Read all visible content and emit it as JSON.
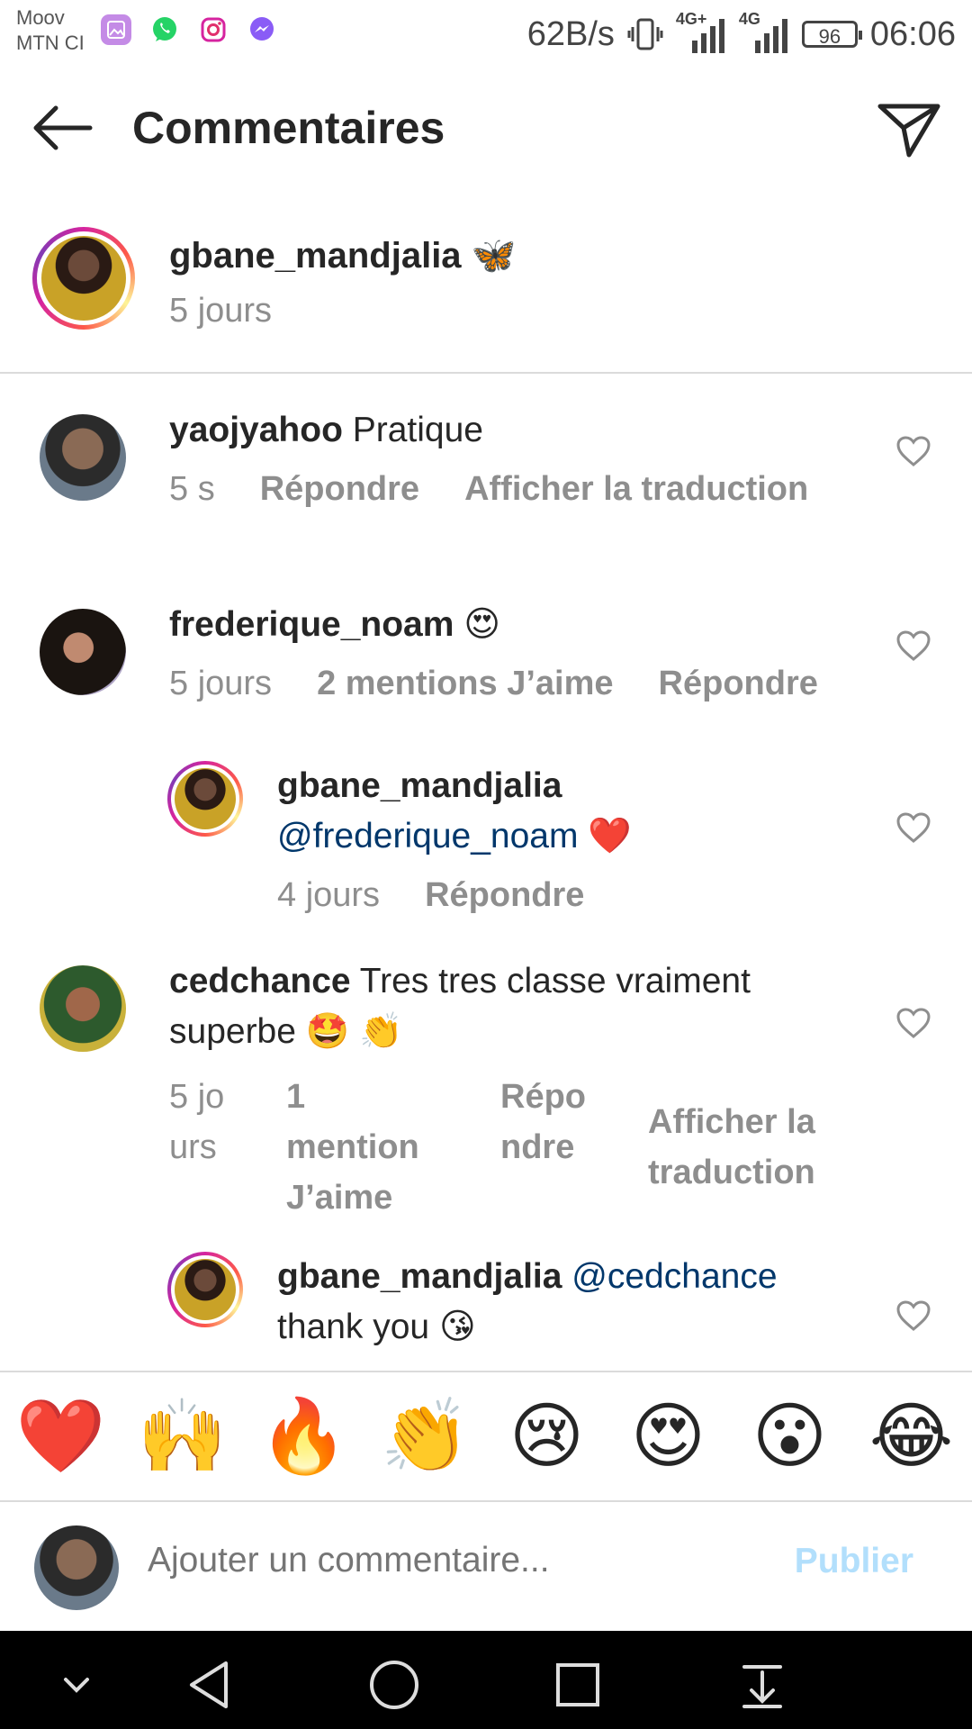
{
  "status_bar": {
    "carrier_line1": "Moov",
    "carrier_line2": "MTN CI",
    "speed": "62B/s",
    "net1": "4G+",
    "net2": "4G",
    "battery": "96",
    "time": "06:06"
  },
  "header": {
    "title": "Commentaires"
  },
  "caption": {
    "username": "gbane_mandjalia",
    "emoji": "🦋",
    "time": "5 jours"
  },
  "comments": [
    {
      "username": "yaojyahoo",
      "text": "Pratique",
      "time": "5 s",
      "reply": "Répondre",
      "translate": "Afficher la traduction"
    },
    {
      "username": "frederique_noam",
      "text": "😍",
      "time": "5 jours",
      "likes": "2 mentions J’aime",
      "reply": "Répondre"
    },
    {
      "username": "gbane_mandjalia",
      "mention": "@frederique_noam",
      "text": "❤️",
      "time": "4 jours",
      "reply": "Répondre"
    },
    {
      "username": "cedchance",
      "text": "Tres tres classe vraiment superbe 🤩 👏",
      "time": "5 jours",
      "likes": "1 mention J’aime",
      "reply": "Répondre",
      "translate": "Afficher la traduction"
    },
    {
      "username": "gbane_mandjalia",
      "mention": "@cedchance",
      "text": "thank you 😘"
    }
  ],
  "reactions": [
    "❤️",
    "🙌",
    "🔥",
    "👏",
    "😢",
    "😍",
    "😮",
    "😂"
  ],
  "composer": {
    "placeholder": "Ajouter un commentaire...",
    "publish": "Publier"
  },
  "colors": {
    "link": "#00376b",
    "meta": "#8e8e8e",
    "publish_disabled": "#b2dffc"
  }
}
